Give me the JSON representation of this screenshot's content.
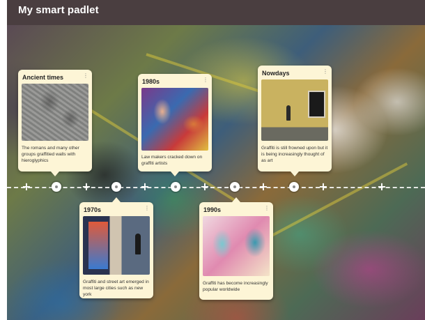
{
  "header": {
    "title": "My smart padlet"
  },
  "timeline": {
    "plus_glyph": "+",
    "cards": [
      {
        "title": "Ancient times",
        "menu_glyph": "⋮",
        "description": "The romans and many other groups graffitied walls with hieroglyphics"
      },
      {
        "title": "1970s",
        "menu_glyph": "⋮",
        "description": "Graffiti and street art emerged in most large cities such as new york"
      },
      {
        "title": "1980s",
        "menu_glyph": "⋮",
        "description": "Law makers cracked down on graffiti artists"
      },
      {
        "title": "1990s",
        "menu_glyph": "⋮",
        "description": "Graffiti has become increasingly popular worldwide"
      },
      {
        "title": "Nowdays",
        "menu_glyph": "⋮",
        "description": "Graffiti is still frowned upon but it is being increasingly thought of as art"
      }
    ]
  },
  "colors": {
    "header_bg": "#4a3e40",
    "card_bg": "#fdf5d6",
    "timeline_line": "#ffffff"
  }
}
